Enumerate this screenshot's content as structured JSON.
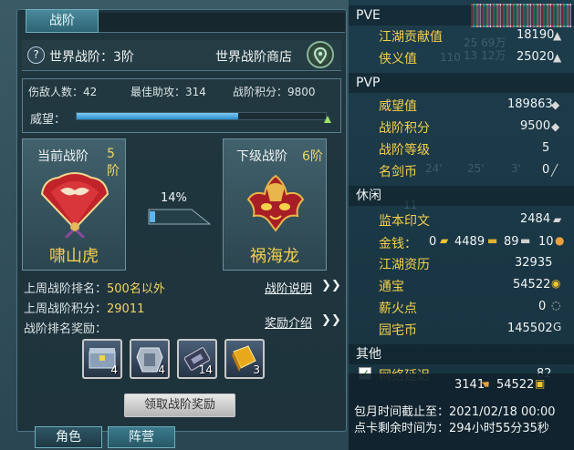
{
  "left": {
    "tab_title": "战阶",
    "help_symbol": "?",
    "world_rank": "世界战阶：3阶",
    "shop_label": "世界战阶商店",
    "stats": {
      "kills": "伤敌人数：42",
      "assist": "最佳助攻：314",
      "points": "战阶积分：9800"
    },
    "prestige_label": "威望：",
    "prestige_progress": 0.65,
    "current": {
      "title": "当前战阶",
      "tier": "5阶",
      "name": "啸山虎"
    },
    "next": {
      "title": "下级战阶",
      "tier": "6阶",
      "name": "祸海龙"
    },
    "progress_pct": "14%",
    "last_week_rank_label": "上周战阶排名：",
    "last_week_rank_value": "500名以外",
    "last_week_points_label": "上周战阶积分：",
    "last_week_points_value": "29011",
    "reward_label": "战阶排名奖励：",
    "link_explain": "战阶说明",
    "link_rewards": "奖励介绍",
    "chevron": "❯❯",
    "rewards": [
      {
        "icon": "chest-icon",
        "count": "4"
      },
      {
        "icon": "armor-icon",
        "count": "4"
      },
      {
        "icon": "scroll-icon",
        "count": "14"
      },
      {
        "icon": "gold-bar-icon",
        "count": "3"
      }
    ],
    "claim_button": "领取战阶奖励",
    "bottom_tabs": [
      "角色",
      "阵营"
    ]
  },
  "right": {
    "pve": {
      "header": "PVE",
      "rows": [
        {
          "label": "江湖贡献值",
          "value": "18190"
        },
        {
          "label": "侠义值",
          "value": "25020"
        }
      ]
    },
    "pvp": {
      "header": "PVP",
      "rows": [
        {
          "label": "威望值",
          "value": "189863"
        },
        {
          "label": "战阶积分",
          "value": "9500"
        },
        {
          "label": "战阶等级",
          "value": "5"
        },
        {
          "label": "名剑币",
          "value": "0"
        }
      ]
    },
    "leisure": {
      "header": "休闲",
      "rows": [
        {
          "label": "监本印文",
          "value": "2484"
        },
        {
          "label": "金钱：",
          "value": "0"
        },
        {
          "label": "江湖资历",
          "value": "32935"
        },
        {
          "label": "通宝",
          "value": "54522"
        },
        {
          "label": "薪火点",
          "value": "0"
        },
        {
          "label": "园宅币",
          "value": "145502"
        }
      ],
      "money_gold": "4489",
      "money_silver": "89",
      "money_copper": "10"
    },
    "other": {
      "header": "其他",
      "row_label": "网络延迟",
      "row_value": "82",
      "check_mark": "✓"
    },
    "ghost_texts": [
      "25 69万",
      "13 12万",
      "110",
      "24'",
      "25'",
      "3'",
      "11"
    ],
    "overlay": {
      "stat1": "3141",
      "stat2": "54522",
      "line1": "包月时间截止至：2021/02/18 00:00",
      "line2": "点卡剩余时间为：294小时55分35秒"
    }
  }
}
